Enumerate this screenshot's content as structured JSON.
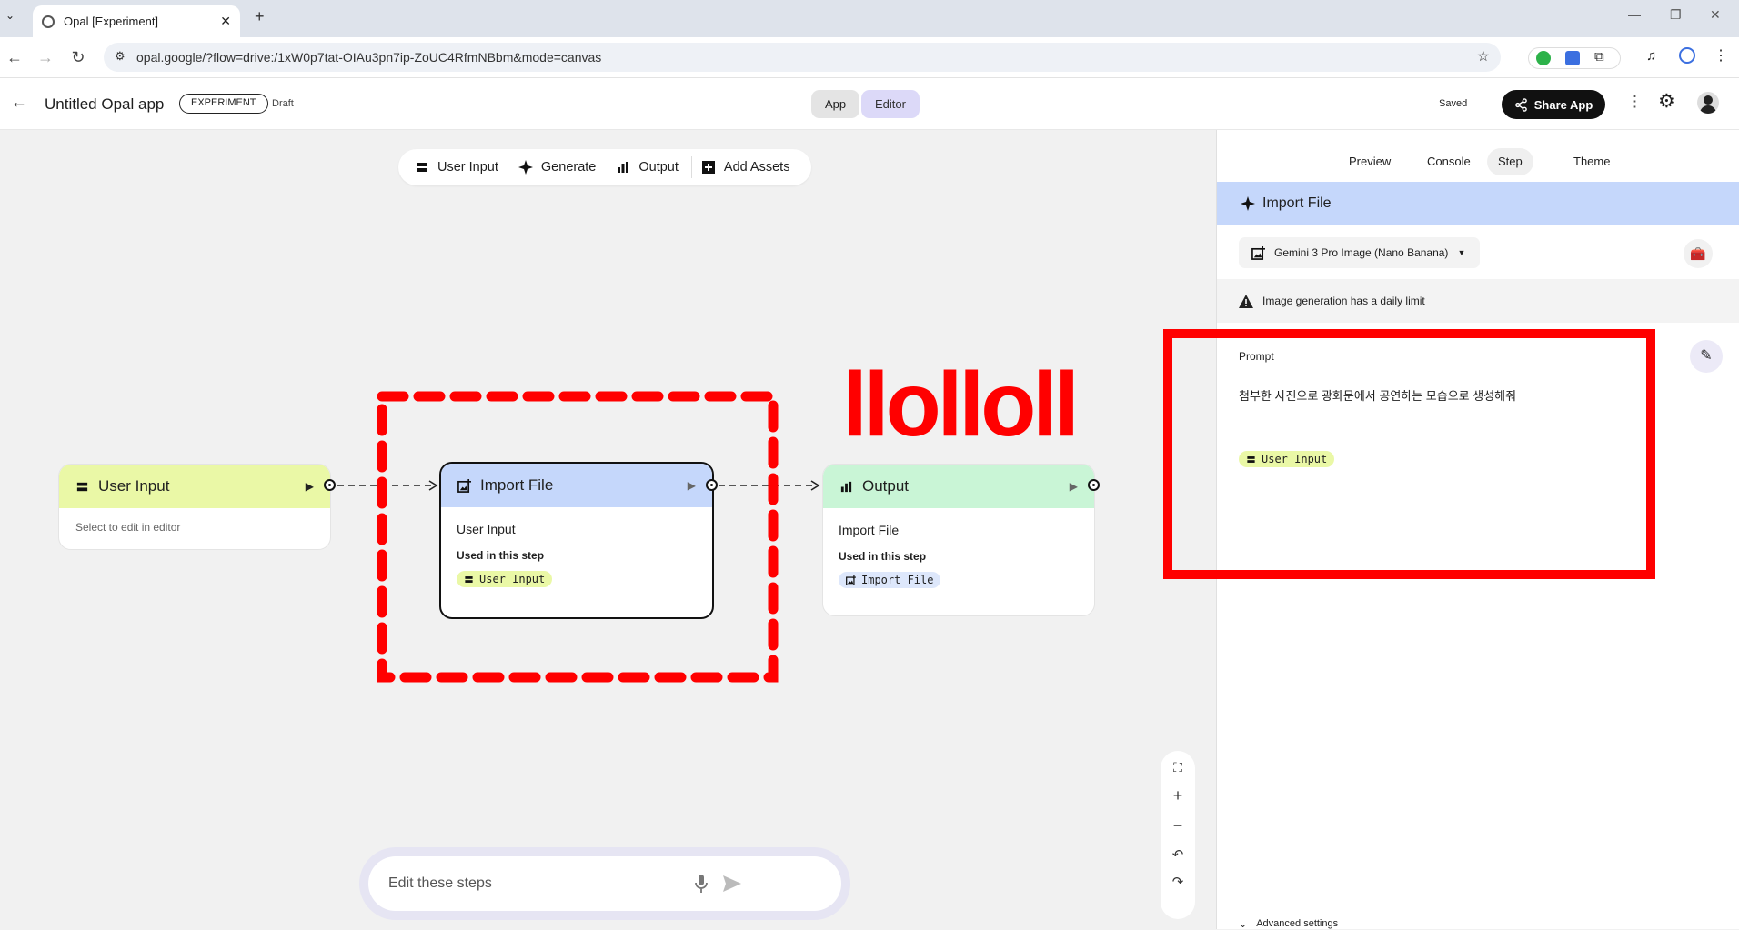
{
  "browser": {
    "tab_title": "Opal [Experiment]",
    "tab_close": "✕",
    "new_tab": "+",
    "url": "opal.google/?flow=drive:/1xW0p7tat-OIAu3pn7ip-ZoUC4RfmNBbm&mode=canvas"
  },
  "header": {
    "app_title": "Untitled Opal app",
    "badge": "EXPERIMENT",
    "status": "Draft",
    "tab_app": "App",
    "tab_editor": "Editor",
    "saved": "Saved",
    "share": "Share App"
  },
  "toolbar": {
    "user_input": "User Input",
    "generate": "Generate",
    "output": "Output",
    "add_assets": "Add Assets"
  },
  "nodes": {
    "user_input": {
      "title": "User Input",
      "body": "Select to edit in editor"
    },
    "import_file": {
      "title": "Import File",
      "body": "User Input",
      "used": "Used in this step",
      "chip": "User Input"
    },
    "output": {
      "title": "Output",
      "body": "Import File",
      "used": "Used in this step",
      "chip": "Import File"
    }
  },
  "annotation_text": "llolloll",
  "panel": {
    "tabs": [
      "Preview",
      "Console",
      "Step",
      "Theme"
    ],
    "step_title": "Import File",
    "model": "Gemini 3 Pro Image (Nano Banana)",
    "warning": "Image generation has a daily limit",
    "prompt_label": "Prompt",
    "prompt_text": "첨부한 사진으로 광화문에서 공연하는 모습으로 생성해줘",
    "prompt_chip": "User Input",
    "advanced": "Advanced settings"
  },
  "editbar": {
    "placeholder": "Edit these steps"
  },
  "colors": {
    "user_input": "#eaf8a6",
    "import_file": "#c5d7fb",
    "output": "#c9f5d6",
    "annotation_red": "#ff0000"
  }
}
